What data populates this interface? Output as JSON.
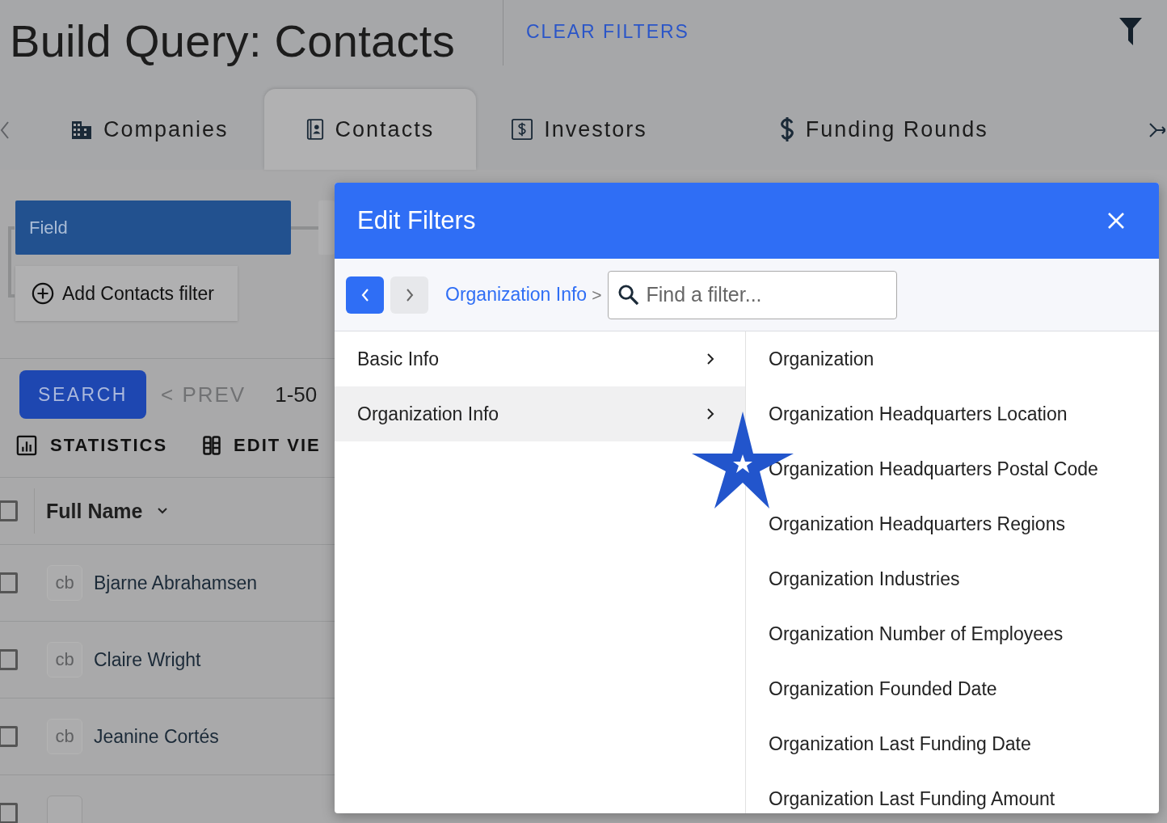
{
  "header": {
    "title": "Build Query: Contacts",
    "clear_filters": "CLEAR FILTERS"
  },
  "tabs": [
    {
      "label": "Companies",
      "selected": false
    },
    {
      "label": "Contacts",
      "selected": true
    },
    {
      "label": "Investors",
      "selected": false
    },
    {
      "label": "Funding Rounds",
      "selected": false
    }
  ],
  "query": {
    "field": "Field",
    "add_filter": "Add Contacts filter"
  },
  "toolbar": {
    "search": "SEARCH",
    "prev": "< PREV",
    "range": "1-50",
    "statistics": "STATISTICS",
    "edit_view": "EDIT VIE"
  },
  "table": {
    "select_all_checked": false,
    "partial_row_checked": false,
    "columns": [
      "Full Name"
    ],
    "rows": [
      {
        "avatar": "cb",
        "name": "Bjarne Abrahamsen",
        "checked": false
      },
      {
        "avatar": "cb",
        "name": "Claire Wright",
        "checked": false
      },
      {
        "avatar": "cb",
        "name": "Jeanine Cortés",
        "checked": false
      }
    ]
  },
  "dialog": {
    "title": "Edit Filters",
    "breadcrumb": "Organization Info",
    "breadcrumb_separator": ">",
    "search_placeholder": "Find a filter...",
    "categories": [
      {
        "label": "Basic Info",
        "selected": false
      },
      {
        "label": "Organization Info",
        "selected": true
      }
    ],
    "filters": [
      "Organization",
      "Organization Headquarters Location",
      "Organization Headquarters Postal Code",
      "Organization Headquarters Regions",
      "Organization Industries",
      "Organization Number of Employees",
      "Organization Founded Date",
      "Organization Last Funding Date",
      "Organization Last Funding Amount"
    ]
  }
}
